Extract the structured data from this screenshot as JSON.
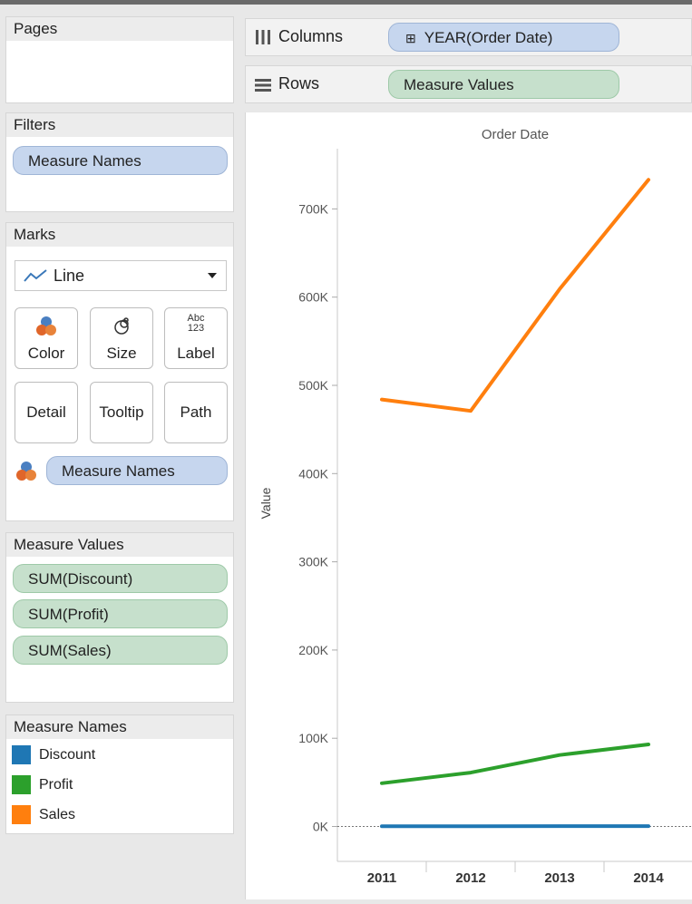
{
  "pages": {
    "title": "Pages"
  },
  "filters": {
    "title": "Filters",
    "pills": [
      "Measure Names"
    ]
  },
  "marks": {
    "title": "Marks",
    "mark_type": "Line",
    "buttons": [
      "Color",
      "Size",
      "Label",
      "Detail",
      "Tooltip",
      "Path"
    ],
    "label_icon_text": [
      "Abc",
      "123"
    ],
    "color_pill": "Measure Names"
  },
  "measure_values": {
    "title": "Measure Values",
    "pills": [
      "SUM(Discount)",
      "SUM(Profit)",
      "SUM(Sales)"
    ]
  },
  "measure_names": {
    "title": "Measure Names",
    "items": [
      {
        "label": "Discount",
        "color": "#1f77b4"
      },
      {
        "label": "Profit",
        "color": "#2ca02c"
      },
      {
        "label": "Sales",
        "color": "#ff7f0e"
      }
    ]
  },
  "shelves": {
    "columns": {
      "name": "Columns",
      "pill": "YEAR(Order Date)",
      "pill_prefix": "⊞"
    },
    "rows": {
      "name": "Rows",
      "pill": "Measure Values"
    }
  },
  "chart_data": {
    "type": "line",
    "title": "Order Date",
    "xlabel": "",
    "ylabel": "Value",
    "categories": [
      "2011",
      "2012",
      "2013",
      "2014"
    ],
    "yticks": [
      "0K",
      "100K",
      "200K",
      "300K",
      "400K",
      "500K",
      "600K",
      "700K"
    ],
    "ylim": [
      0,
      760000
    ],
    "grid": false,
    "series": [
      {
        "name": "Discount",
        "color": "#1f77b4",
        "values": [
          320,
          330,
          400,
          450
        ]
      },
      {
        "name": "Profit",
        "color": "#2ca02c",
        "values": [
          49000,
          61000,
          81000,
          93000
        ]
      },
      {
        "name": "Sales",
        "color": "#ff7f0e",
        "values": [
          484000,
          471000,
          609000,
          733000
        ]
      }
    ]
  }
}
